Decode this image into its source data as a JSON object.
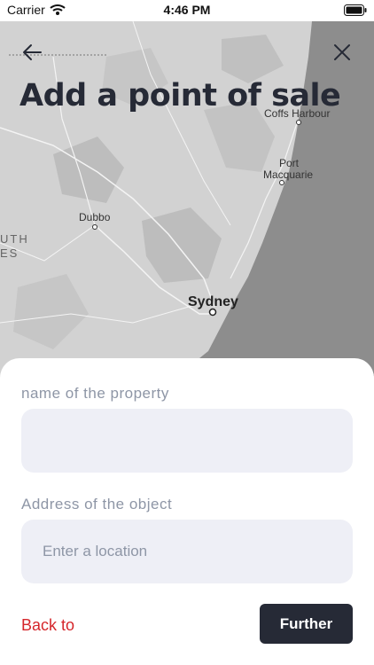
{
  "status_bar": {
    "carrier": "Carrier",
    "time": "4:46 PM",
    "icons": [
      "wifi-icon",
      "battery-icon"
    ]
  },
  "header": {
    "title": "Add a point of sale",
    "back_icon": "arrow-left-icon",
    "close_icon": "close-icon"
  },
  "map": {
    "labels": [
      "Coffs Harbour",
      "Port",
      "Macquarie",
      "Dubbo",
      "Sydney",
      "UTH",
      "ES"
    ],
    "colors": {
      "land": "#d2d2d2",
      "sea": "#8d8d8d",
      "highland": "#bdbdbd",
      "roads": "#ffffff"
    }
  },
  "form": {
    "name_label": "name of the property",
    "name_value": "",
    "name_placeholder": "",
    "address_label": "Address of the object",
    "address_value": "",
    "address_placeholder": "Enter a location"
  },
  "actions": {
    "back_label": "Back to",
    "further_label": "Further"
  },
  "colors": {
    "accent_dark": "#262a36",
    "link_red": "#d5262b",
    "field_bg": "#eeeff6",
    "label_gray": "#8e96a6"
  }
}
